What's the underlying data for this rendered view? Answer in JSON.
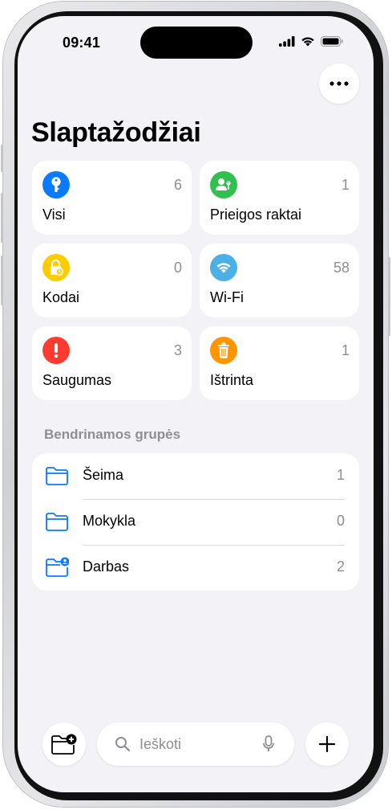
{
  "status_bar": {
    "time": "09:41"
  },
  "header": {
    "title": "Slaptažodžiai",
    "more_icon": "ellipsis-icon"
  },
  "categories": [
    {
      "label": "Visi",
      "count": "6",
      "icon": "key-icon",
      "color": "#0a7aff"
    },
    {
      "label": "Prieigos raktai",
      "count": "1",
      "icon": "person-badge-key-icon",
      "color": "#30c04f"
    },
    {
      "label": "Kodai",
      "count": "0",
      "icon": "lock-clock-icon",
      "color": "#ffcc00"
    },
    {
      "label": "Wi-Fi",
      "count": "58",
      "icon": "wifi-icon",
      "color": "#4ab0e6"
    },
    {
      "label": "Saugumas",
      "count": "3",
      "icon": "exclamation-icon",
      "color": "#ff3b30"
    },
    {
      "label": "Ištrinta",
      "count": "1",
      "icon": "trash-icon",
      "color": "#ff9500"
    }
  ],
  "shared_groups": {
    "title": "Bendrinamos grupės",
    "items": [
      {
        "label": "Šeima",
        "count": "1",
        "icon": "folder-icon"
      },
      {
        "label": "Mokykla",
        "count": "0",
        "icon": "folder-icon"
      },
      {
        "label": "Darbas",
        "count": "2",
        "icon": "folder-person-icon"
      }
    ]
  },
  "toolbar": {
    "search_placeholder": "Ieškoti",
    "new_group_icon": "folder-plus-icon",
    "add_icon": "plus-icon",
    "mic_icon": "microphone-icon"
  },
  "colors": {
    "accent": "#0a7aff",
    "background": "#f2f2f7",
    "secondary_text": "#8e8e93"
  }
}
